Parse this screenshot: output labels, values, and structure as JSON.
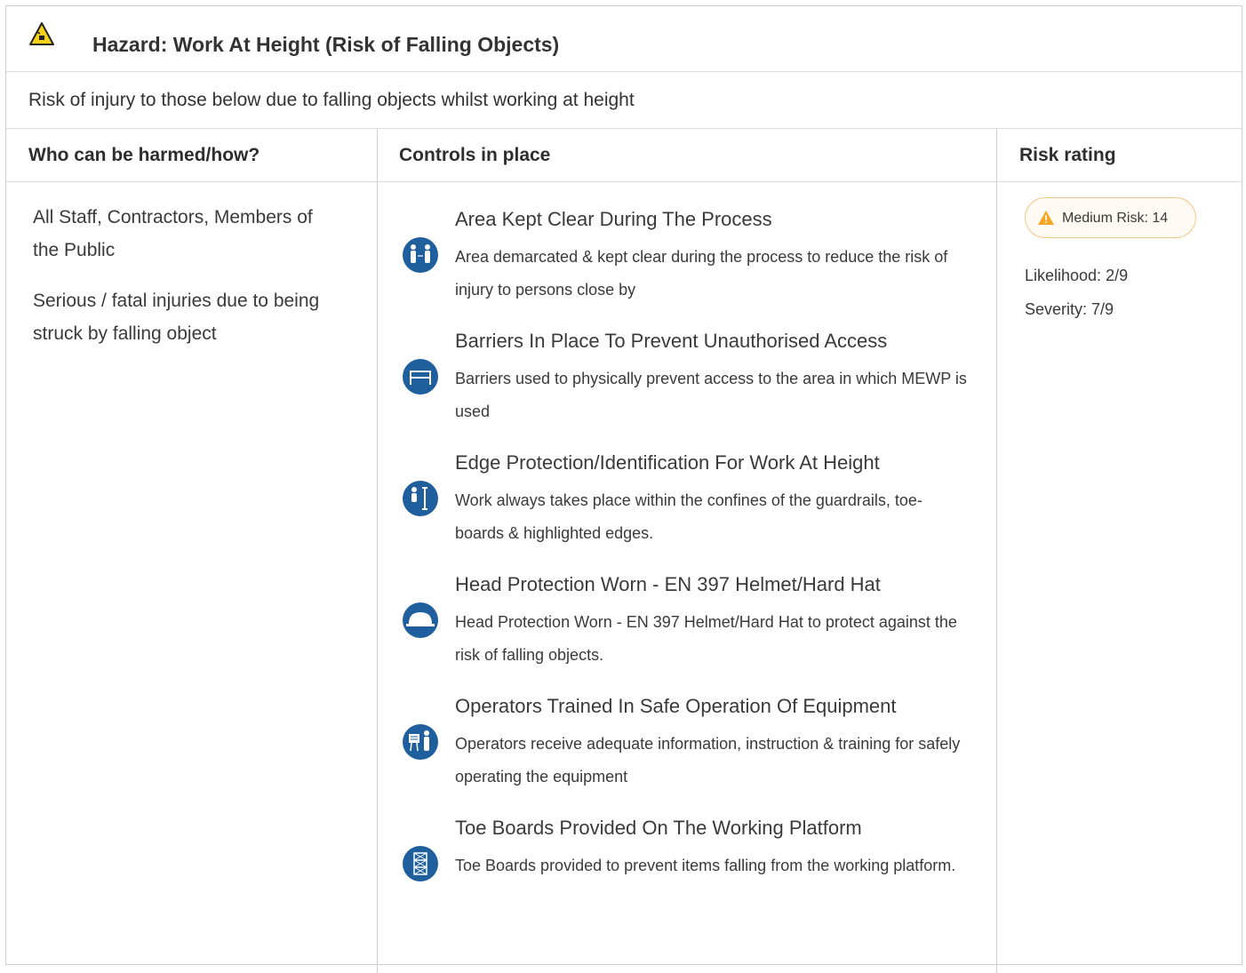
{
  "hazard": {
    "title": "Hazard:  Work At Height (Risk of Falling Objects)",
    "description": "Risk of injury to those below due to falling objects whilst working at height",
    "icon": "falling-object-warning-icon"
  },
  "table": {
    "headers": [
      "Who can be harmed/how?",
      "Controls in place",
      "Risk rating"
    ]
  },
  "harmed": {
    "who": "All Staff, Contractors, Members of the Public",
    "how": "Serious / fatal injuries due to being struck by falling object"
  },
  "controls": [
    {
      "title": "Area Kept Clear During The Process",
      "description": "Area demarcated & kept clear during the process to reduce the risk of injury to persons close by",
      "icon": "keep-distance-icon"
    },
    {
      "title": "Barriers In Place To Prevent Unauthorised Access",
      "description": "Barriers used to physically prevent access to the area in which MEWP is used",
      "icon": "barrier-icon"
    },
    {
      "title": "Edge Protection/Identification For Work At Height",
      "description": "Work always takes place within the confines of the guardrails, toe-boards & highlighted edges.",
      "icon": "edge-protection-icon"
    },
    {
      "title": "Head Protection Worn - EN 397 Helmet/Hard Hat",
      "description": "Head Protection Worn - EN 397 Helmet/Hard Hat to protect against the risk of falling objects.",
      "icon": "hard-hat-icon"
    },
    {
      "title": "Operators Trained In Safe Operation Of Equipment",
      "description": "Operators receive adequate information, instruction & training for safely operating the equipment",
      "icon": "training-icon"
    },
    {
      "title": "Toe Boards Provided On The Working Platform",
      "description": "Toe Boards provided to prevent items falling from the working platform.",
      "icon": "scaffold-icon"
    }
  ],
  "risk": {
    "badge": "Medium Risk: 14",
    "likelihood": "Likelihood: 2/9",
    "severity": "Severity: 7/9",
    "badge_border_color": "#f3c98a",
    "warning_color": "#f5a623"
  },
  "colors": {
    "icon_blue": "#1f5f9e",
    "hazard_yellow": "#f7d117"
  }
}
